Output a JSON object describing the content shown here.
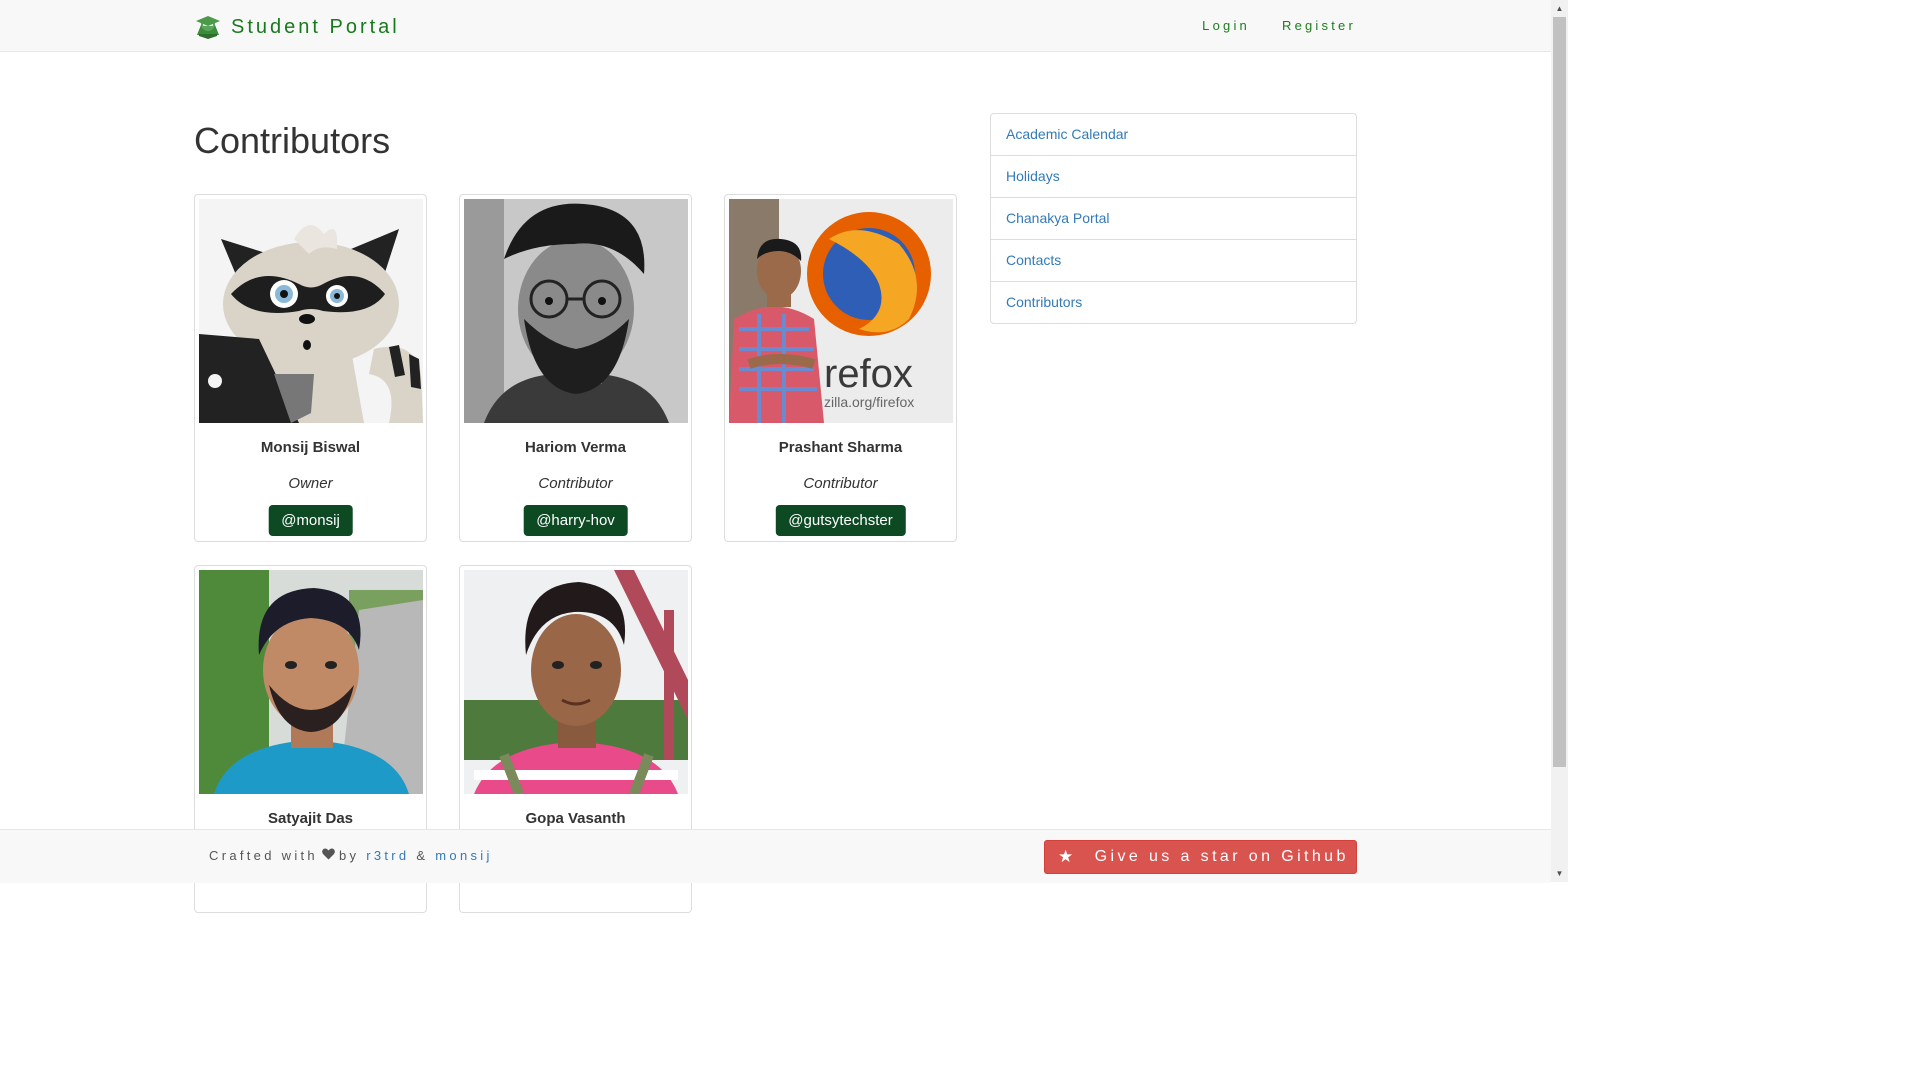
{
  "navbar": {
    "brand": "Student Portal",
    "links": [
      "Login",
      "Register"
    ]
  },
  "main": {
    "title": "Contributors",
    "contributors": [
      {
        "name": "Monsij Biswal",
        "role": "Owner",
        "handle": "@monsij"
      },
      {
        "name": "Hariom Verma",
        "role": "Contributor",
        "handle": "@harry-hov"
      },
      {
        "name": "Prashant Sharma",
        "role": "Contributor",
        "handle": "@gutsytechster"
      },
      {
        "name": "Satyajit Das",
        "role": "",
        "handle": ""
      },
      {
        "name": "Gopa Vasanth",
        "role": "",
        "handle": ""
      }
    ]
  },
  "sidebar": {
    "items": [
      "Academic Calendar",
      "Holidays",
      "Chanakya Portal",
      "Contacts",
      "Contributors"
    ]
  },
  "footer": {
    "crafted": "Crafted with",
    "by": "by",
    "author1": "r3trd",
    "amp": "&",
    "author2": "monsij",
    "github_button": "Give us a star on Github"
  },
  "colors": {
    "brand_green": "#187a1c",
    "handle_button": "#0d4a24",
    "link_blue": "#337ab7",
    "github_red": "#d9534f"
  },
  "icons": [
    "graduation-cap-icon",
    "heart-icon",
    "star-icon"
  ]
}
